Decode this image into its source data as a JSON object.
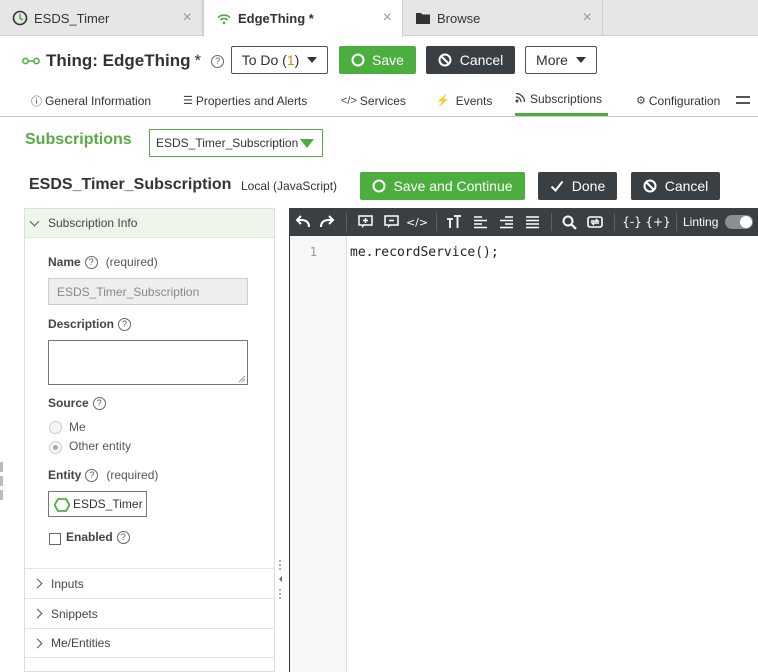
{
  "browser_tabs": [
    {
      "label": "ESDS_Timer",
      "icon": "clock-icon",
      "active": false
    },
    {
      "label": "EdgeThing *",
      "icon": "wifi-icon",
      "active": true
    },
    {
      "label": "Browse",
      "icon": "folder-icon",
      "active": false
    }
  ],
  "header": {
    "title": "Thing: EdgeThing",
    "modified_marker": "*",
    "help": "?",
    "todo_label": "To Do (",
    "todo_count": "1",
    "todo_close": ")",
    "save_label": "Save",
    "cancel_label": "Cancel",
    "more_label": "More"
  },
  "page_tabs": [
    {
      "label": "General Information",
      "icon": "info-icon"
    },
    {
      "label": "Properties and Alerts",
      "icon": "list-icon"
    },
    {
      "label": "Services",
      "icon": "code-icon"
    },
    {
      "label": "Events",
      "icon": "bolt-icon"
    },
    {
      "label": "Subscriptions",
      "icon": "feed-icon",
      "active": true
    },
    {
      "label": "Configuration",
      "icon": "gear-icon"
    }
  ],
  "subscriptions": {
    "label": "Subscriptions",
    "selected": "ESDS_Timer_Subscription"
  },
  "subscription": {
    "title": "ESDS_Timer_Subscription",
    "subtitle": "Local (JavaScript)",
    "save_continue_label": "Save and Continue",
    "done_label": "Done",
    "cancel_label": "Cancel"
  },
  "info_panel": {
    "header": "Subscription Info",
    "name_label": "Name",
    "required_text": "(required)",
    "name_value": "ESDS_Timer_Subscription",
    "description_label": "Description",
    "source_label": "Source",
    "source_options": [
      "Me",
      "Other entity"
    ],
    "source_selected": "Other entity",
    "entity_label": "Entity",
    "entity_value": "ESDS_Timer",
    "enabled_label": "Enabled",
    "enabled": false,
    "sections": [
      "Inputs",
      "Snippets",
      "Me/Entities"
    ]
  },
  "editor": {
    "linting_label": "Linting",
    "linting_on": true,
    "line_numbers": [
      "1"
    ],
    "code_lines": [
      "me.recordService();"
    ]
  },
  "colors": {
    "accent_green": "#4cae3f",
    "dark_button": "#3a3f44",
    "todo_count": "#e08a00"
  }
}
